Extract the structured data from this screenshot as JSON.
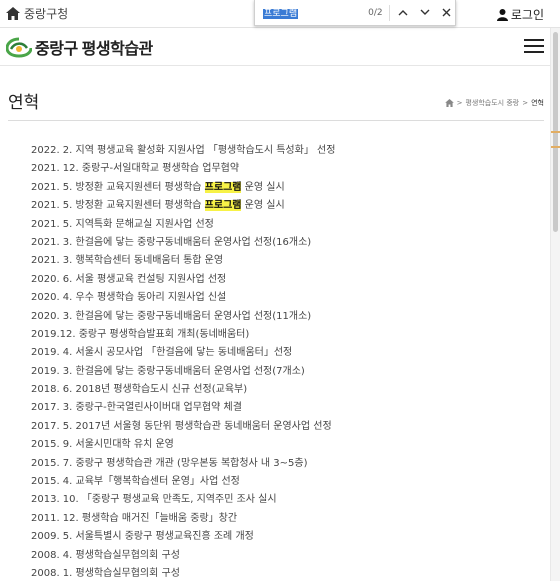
{
  "topbar": {
    "home_label": "중랑구청",
    "login_label": "로그인"
  },
  "find_bar": {
    "query": "프로그램",
    "count": "0/2"
  },
  "header": {
    "logo_main": "중랑구",
    "logo_sub": "평생학습관",
    "logo_color": "#4aa548"
  },
  "page": {
    "title": "연혁",
    "breadcrumb": [
      "평생학습도시 중랑",
      "연혁"
    ]
  },
  "history": [
    {
      "before": "2022. 2. 지역 평생교육 활성화 지원사업 「평생학습도시 특성화」 선정",
      "hl": "",
      "after": ""
    },
    {
      "before": "2021. 12. 중랑구-서일대학교 평생학습 업무협약",
      "hl": "",
      "after": ""
    },
    {
      "before": "2021. 5. 방정환 교육지원센터 평생학습 ",
      "hl": "프로그램",
      "after": " 운영 실시"
    },
    {
      "before": "2021. 5. 방정환 교육지원센터 평생학습 ",
      "hl": "프로그램",
      "after": " 운영 실시"
    },
    {
      "before": "2021. 5. 지역특화 문해교실 지원사업 선정",
      "hl": "",
      "after": ""
    },
    {
      "before": "2021. 3. 한걸음에 닿는 중랑구동네배움터 운영사업 선정(16개소)",
      "hl": "",
      "after": ""
    },
    {
      "before": "2021. 3. 행복학습센터 동네배움터 통합 운영",
      "hl": "",
      "after": ""
    },
    {
      "before": "2020. 6. 서울 평생교육 컨설팅 지원사업 선정",
      "hl": "",
      "after": ""
    },
    {
      "before": "2020. 4. 우수 평생학습 동아리 지원사업 신설",
      "hl": "",
      "after": ""
    },
    {
      "before": "2020. 3. 한걸음에 닿는 중랑구동네배움터 운영사업 선정(11개소)",
      "hl": "",
      "after": ""
    },
    {
      "before": "2019.12. 중랑구 평생학습발표회 개최(동네배움터)",
      "hl": "",
      "after": ""
    },
    {
      "before": "2019. 4. 서울시 공모사업 「한걸음에 닿는 동네배움터」선정",
      "hl": "",
      "after": ""
    },
    {
      "before": "2019. 3. 한걸음에 닿는 중랑구동네배움터 운영사업 선정(7개소)",
      "hl": "",
      "after": ""
    },
    {
      "before": "2018. 6. 2018년 평생학습도시 신규 선정(교육부)",
      "hl": "",
      "after": ""
    },
    {
      "before": "2017. 3. 중랑구-한국열린사이버대 업무협약 체결",
      "hl": "",
      "after": ""
    },
    {
      "before": "2017. 5. 2017년 서울형 동단위 평생학습관 동네배움터 운영사업 선정",
      "hl": "",
      "after": ""
    },
    {
      "before": "2015. 9. 서울시민대학 유치 운영",
      "hl": "",
      "after": ""
    },
    {
      "before": "2015. 7. 중랑구 평생학습관 개관 (망우본동 복합청사 내 3~5층)",
      "hl": "",
      "after": ""
    },
    {
      "before": "2015. 4. 교육부「행복학습센터 운영」사업 선정",
      "hl": "",
      "after": ""
    },
    {
      "before": "2013. 10. 「중랑구 평생교육 만족도, 지역주민 조사 실시",
      "hl": "",
      "after": ""
    },
    {
      "before": "2011. 12. 평생학습 매거진「늘배움 중랑」창간",
      "hl": "",
      "after": ""
    },
    {
      "before": "2009. 5. 서울특별시 중랑구 평생교육진흥 조례 개정",
      "hl": "",
      "after": ""
    },
    {
      "before": "2008. 4. 평생학습실무협의회 구성",
      "hl": "",
      "after": ""
    },
    {
      "before": "2008. 1. 평생학습실무협의회 구성",
      "hl": "",
      "after": ""
    }
  ]
}
